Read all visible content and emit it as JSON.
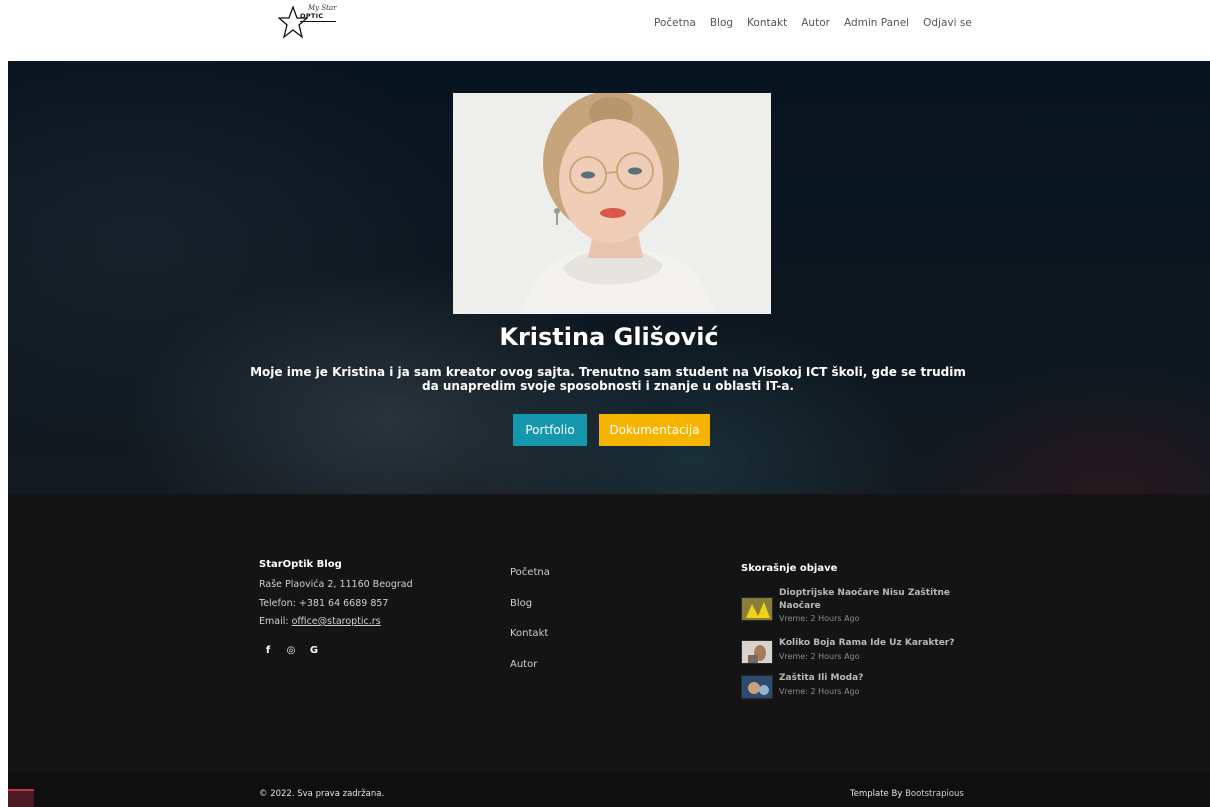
{
  "nav": {
    "logo_text": "OPTIC",
    "logo_script": "My Star",
    "links": [
      "Početna",
      "Blog",
      "Kontakt",
      "Autor",
      "Admin Panel",
      "Odjavi se"
    ]
  },
  "hero": {
    "name": "Kristina Glišović",
    "description": "Moje ime je Kristina i ja sam kreator ovog sajta. Trenutno sam student na Visokoj ICT školi, gde se trudim da unapredim svoje sposobnosti i znanje u oblasti IT-a.",
    "portfolio_label": "Portfolio",
    "docs_label": "Dokumentacija",
    "colors": {
      "portfolio": "#1597ae",
      "docs": "#f5b400"
    }
  },
  "footer": {
    "brand": "StarOptik Blog",
    "address": "Raše Plaovića 2, 11160 Beograd",
    "phone": "Telefon: +381 64 6689 857",
    "email_prefix": "Email: ",
    "email": "office@staroptic.rs",
    "social": [
      {
        "icon": "facebook-icon",
        "glyph": "f"
      },
      {
        "icon": "instagram-icon",
        "glyph": "◎"
      },
      {
        "icon": "google-icon",
        "glyph": "G"
      }
    ],
    "links": [
      "Početna",
      "Blog",
      "Kontakt",
      "Autor"
    ],
    "recent_title": "Skorašnje objave",
    "posts": [
      {
        "title": "Dioptrijske Naočare Nisu Zaštitne Naočare",
        "time": "Vreme: 2 Hours Ago"
      },
      {
        "title": "Koliko Boja Rama Ide Uz Karakter?",
        "time": "Vreme: 2 Hours Ago"
      },
      {
        "title": "Zaštita Ili Moda?",
        "time": "Vreme: 2 Hours Ago"
      }
    ]
  },
  "bottom": {
    "copyright": "© 2022. Sva prava zadržana.",
    "credit_prefix": "Template By ",
    "credit_link": "Bootstrapious"
  }
}
